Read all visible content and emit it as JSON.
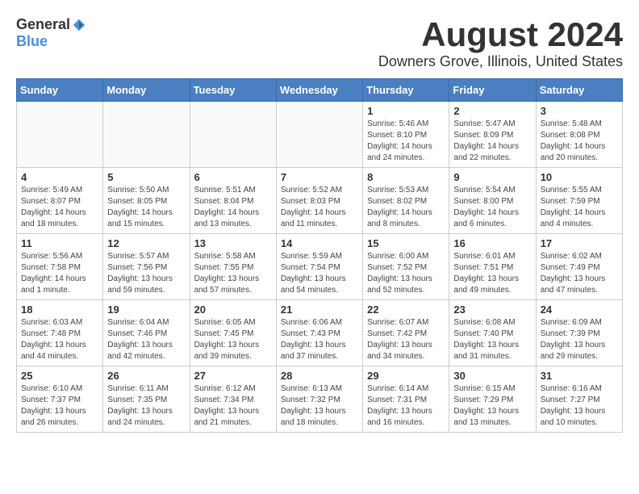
{
  "header": {
    "logo_general": "General",
    "logo_blue": "Blue",
    "month_title": "August 2024",
    "location": "Downers Grove, Illinois, United States"
  },
  "calendar": {
    "days_of_week": [
      "Sunday",
      "Monday",
      "Tuesday",
      "Wednesday",
      "Thursday",
      "Friday",
      "Saturday"
    ],
    "weeks": [
      [
        {
          "day": "",
          "info": ""
        },
        {
          "day": "",
          "info": ""
        },
        {
          "day": "",
          "info": ""
        },
        {
          "day": "",
          "info": ""
        },
        {
          "day": "1",
          "info": "Sunrise: 5:46 AM\nSunset: 8:10 PM\nDaylight: 14 hours and 24 minutes."
        },
        {
          "day": "2",
          "info": "Sunrise: 5:47 AM\nSunset: 8:09 PM\nDaylight: 14 hours and 22 minutes."
        },
        {
          "day": "3",
          "info": "Sunrise: 5:48 AM\nSunset: 8:08 PM\nDaylight: 14 hours and 20 minutes."
        }
      ],
      [
        {
          "day": "4",
          "info": "Sunrise: 5:49 AM\nSunset: 8:07 PM\nDaylight: 14 hours and 18 minutes."
        },
        {
          "day": "5",
          "info": "Sunrise: 5:50 AM\nSunset: 8:05 PM\nDaylight: 14 hours and 15 minutes."
        },
        {
          "day": "6",
          "info": "Sunrise: 5:51 AM\nSunset: 8:04 PM\nDaylight: 14 hours and 13 minutes."
        },
        {
          "day": "7",
          "info": "Sunrise: 5:52 AM\nSunset: 8:03 PM\nDaylight: 14 hours and 11 minutes."
        },
        {
          "day": "8",
          "info": "Sunrise: 5:53 AM\nSunset: 8:02 PM\nDaylight: 14 hours and 8 minutes."
        },
        {
          "day": "9",
          "info": "Sunrise: 5:54 AM\nSunset: 8:00 PM\nDaylight: 14 hours and 6 minutes."
        },
        {
          "day": "10",
          "info": "Sunrise: 5:55 AM\nSunset: 7:59 PM\nDaylight: 14 hours and 4 minutes."
        }
      ],
      [
        {
          "day": "11",
          "info": "Sunrise: 5:56 AM\nSunset: 7:58 PM\nDaylight: 14 hours and 1 minute."
        },
        {
          "day": "12",
          "info": "Sunrise: 5:57 AM\nSunset: 7:56 PM\nDaylight: 13 hours and 59 minutes."
        },
        {
          "day": "13",
          "info": "Sunrise: 5:58 AM\nSunset: 7:55 PM\nDaylight: 13 hours and 57 minutes."
        },
        {
          "day": "14",
          "info": "Sunrise: 5:59 AM\nSunset: 7:54 PM\nDaylight: 13 hours and 54 minutes."
        },
        {
          "day": "15",
          "info": "Sunrise: 6:00 AM\nSunset: 7:52 PM\nDaylight: 13 hours and 52 minutes."
        },
        {
          "day": "16",
          "info": "Sunrise: 6:01 AM\nSunset: 7:51 PM\nDaylight: 13 hours and 49 minutes."
        },
        {
          "day": "17",
          "info": "Sunrise: 6:02 AM\nSunset: 7:49 PM\nDaylight: 13 hours and 47 minutes."
        }
      ],
      [
        {
          "day": "18",
          "info": "Sunrise: 6:03 AM\nSunset: 7:48 PM\nDaylight: 13 hours and 44 minutes."
        },
        {
          "day": "19",
          "info": "Sunrise: 6:04 AM\nSunset: 7:46 PM\nDaylight: 13 hours and 42 minutes."
        },
        {
          "day": "20",
          "info": "Sunrise: 6:05 AM\nSunset: 7:45 PM\nDaylight: 13 hours and 39 minutes."
        },
        {
          "day": "21",
          "info": "Sunrise: 6:06 AM\nSunset: 7:43 PM\nDaylight: 13 hours and 37 minutes."
        },
        {
          "day": "22",
          "info": "Sunrise: 6:07 AM\nSunset: 7:42 PM\nDaylight: 13 hours and 34 minutes."
        },
        {
          "day": "23",
          "info": "Sunrise: 6:08 AM\nSunset: 7:40 PM\nDaylight: 13 hours and 31 minutes."
        },
        {
          "day": "24",
          "info": "Sunrise: 6:09 AM\nSunset: 7:39 PM\nDaylight: 13 hours and 29 minutes."
        }
      ],
      [
        {
          "day": "25",
          "info": "Sunrise: 6:10 AM\nSunset: 7:37 PM\nDaylight: 13 hours and 26 minutes."
        },
        {
          "day": "26",
          "info": "Sunrise: 6:11 AM\nSunset: 7:35 PM\nDaylight: 13 hours and 24 minutes."
        },
        {
          "day": "27",
          "info": "Sunrise: 6:12 AM\nSunset: 7:34 PM\nDaylight: 13 hours and 21 minutes."
        },
        {
          "day": "28",
          "info": "Sunrise: 6:13 AM\nSunset: 7:32 PM\nDaylight: 13 hours and 18 minutes."
        },
        {
          "day": "29",
          "info": "Sunrise: 6:14 AM\nSunset: 7:31 PM\nDaylight: 13 hours and 16 minutes."
        },
        {
          "day": "30",
          "info": "Sunrise: 6:15 AM\nSunset: 7:29 PM\nDaylight: 13 hours and 13 minutes."
        },
        {
          "day": "31",
          "info": "Sunrise: 6:16 AM\nSunset: 7:27 PM\nDaylight: 13 hours and 10 minutes."
        }
      ]
    ]
  }
}
